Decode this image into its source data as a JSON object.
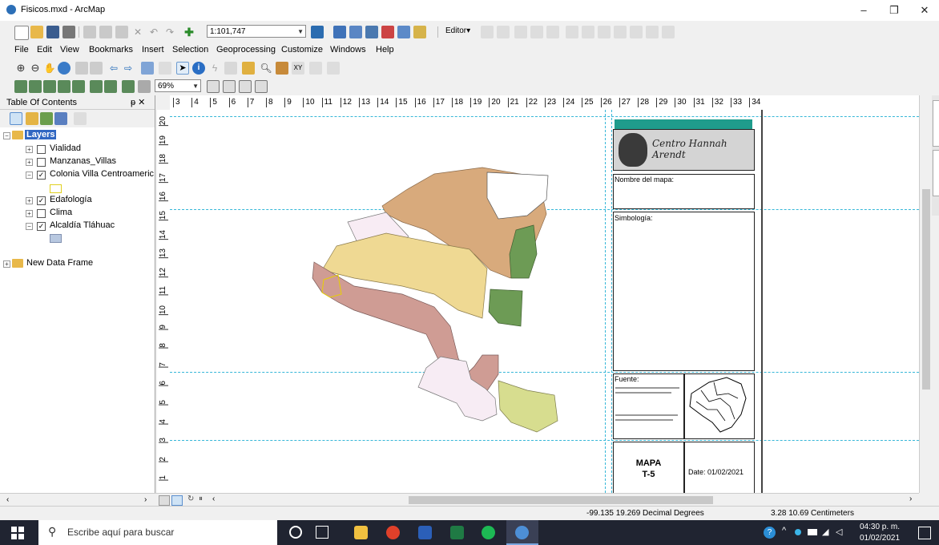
{
  "window": {
    "title": "Fisicos.mxd - ArcMap",
    "minimize": "–",
    "maximize": "❐",
    "close": "✕"
  },
  "toolbar": {
    "scale_value": "1:101,747",
    "editor_label": "Editor▾",
    "zoom_value": "69%"
  },
  "menu": [
    "File",
    "Edit",
    "View",
    "Bookmarks",
    "Insert",
    "Selection",
    "Geoprocessing",
    "Customize",
    "Windows",
    "Help"
  ],
  "toc": {
    "title": "Table Of Contents",
    "pin": "ᵽ ✕",
    "root": "Layers",
    "layers": [
      {
        "name": "Vialidad",
        "checked": false
      },
      {
        "name": "Manzanas_Villas",
        "checked": false
      },
      {
        "name": "Colonia Villa Centroamerica",
        "checked": true
      },
      {
        "name": "Edafología",
        "checked": true
      },
      {
        "name": "Clima",
        "checked": false
      },
      {
        "name": "Alcaldía Tláhuac",
        "checked": true
      }
    ],
    "new_frame": "New Data Frame",
    "colors": {
      "colonia_symbol": "#ffff66",
      "alcaldia_symbol": "#b8c8e0"
    }
  },
  "ruler_top": [
    "3",
    "4",
    "5",
    "6",
    "7",
    "8",
    "9",
    "10",
    "11",
    "12",
    "13",
    "14",
    "15",
    "16",
    "17",
    "18",
    "19",
    "20",
    "21",
    "22",
    "23",
    "24",
    "25",
    "26",
    "27",
    "28",
    "29",
    "30",
    "31",
    "32",
    "33",
    "34"
  ],
  "ruler_left": [
    "20",
    "19",
    "18",
    "17",
    "16",
    "15",
    "14",
    "13",
    "12",
    "11",
    "10",
    "9",
    "8",
    "7",
    "6",
    "5",
    "4",
    "3",
    "2",
    "1"
  ],
  "layout": {
    "logo_text": "Centro Hannah Arendt",
    "map_name_label": "Nombre del mapa:",
    "legend_label": "Simbología:",
    "source_label": "Fuente:",
    "map_title_line1": "MAPA",
    "map_title_line2": "T-5",
    "date": "Date: 01/02/2021"
  },
  "status": {
    "coords": "-99.135  19.269 Decimal Degrees",
    "page_coords": "3.28  10.69 Centimeters"
  },
  "taskbar": {
    "search_placeholder": "Escribe aquí para buscar",
    "time": "04:30 p. m.",
    "date": "01/02/2021"
  },
  "colors": {
    "accent_teal": "#1f9c8c",
    "taskbar_bg": "#202431"
  }
}
